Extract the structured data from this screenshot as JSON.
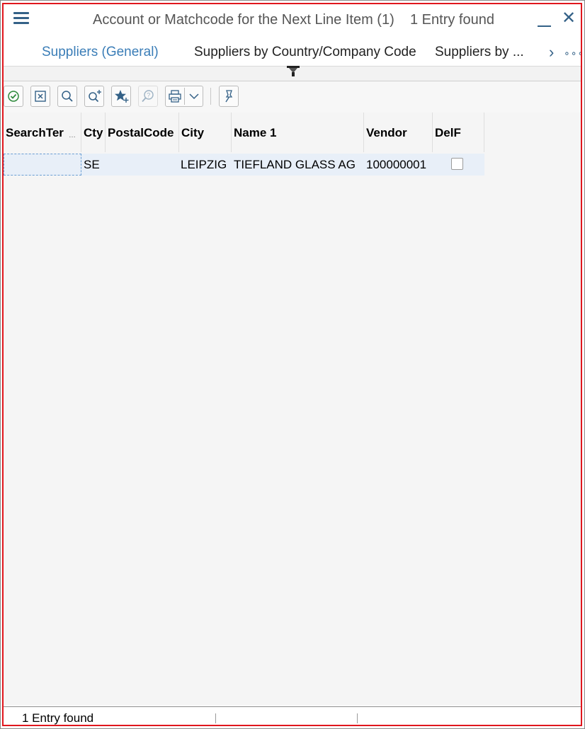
{
  "window": {
    "title": "Account or Matchcode for the Next Line Item (1)",
    "count_text": "1 Entry found"
  },
  "tabs": [
    {
      "label": "Suppliers (General)",
      "active": true
    },
    {
      "label": "Suppliers by Country/Company Code",
      "active": false
    },
    {
      "label": "Suppliers by ...",
      "active": false
    }
  ],
  "toolbar": {
    "icons": [
      "check-icon",
      "cancel-icon",
      "search-icon",
      "search-more-icon",
      "favorite-add-icon",
      "help-icon",
      "print-icon",
      "dropdown-icon",
      "pin-icon"
    ]
  },
  "table": {
    "headers": [
      "SearchTer",
      "Cty",
      "PostalCode",
      "City",
      "Name 1",
      "Vendor",
      "DelF"
    ],
    "rows": [
      {
        "searchterm": "",
        "cty": "SE",
        "postalcode": "",
        "city": "LEIPZIG",
        "name1": "TIEFLAND GLASS AG",
        "vendor": "100000001",
        "delf": false
      }
    ]
  },
  "status": {
    "text": "1 Entry found"
  },
  "colors": {
    "accent": "#346187",
    "active_tab": "#3a7db7",
    "frame": "#e0161d",
    "row_selected": "#e8eff8"
  }
}
